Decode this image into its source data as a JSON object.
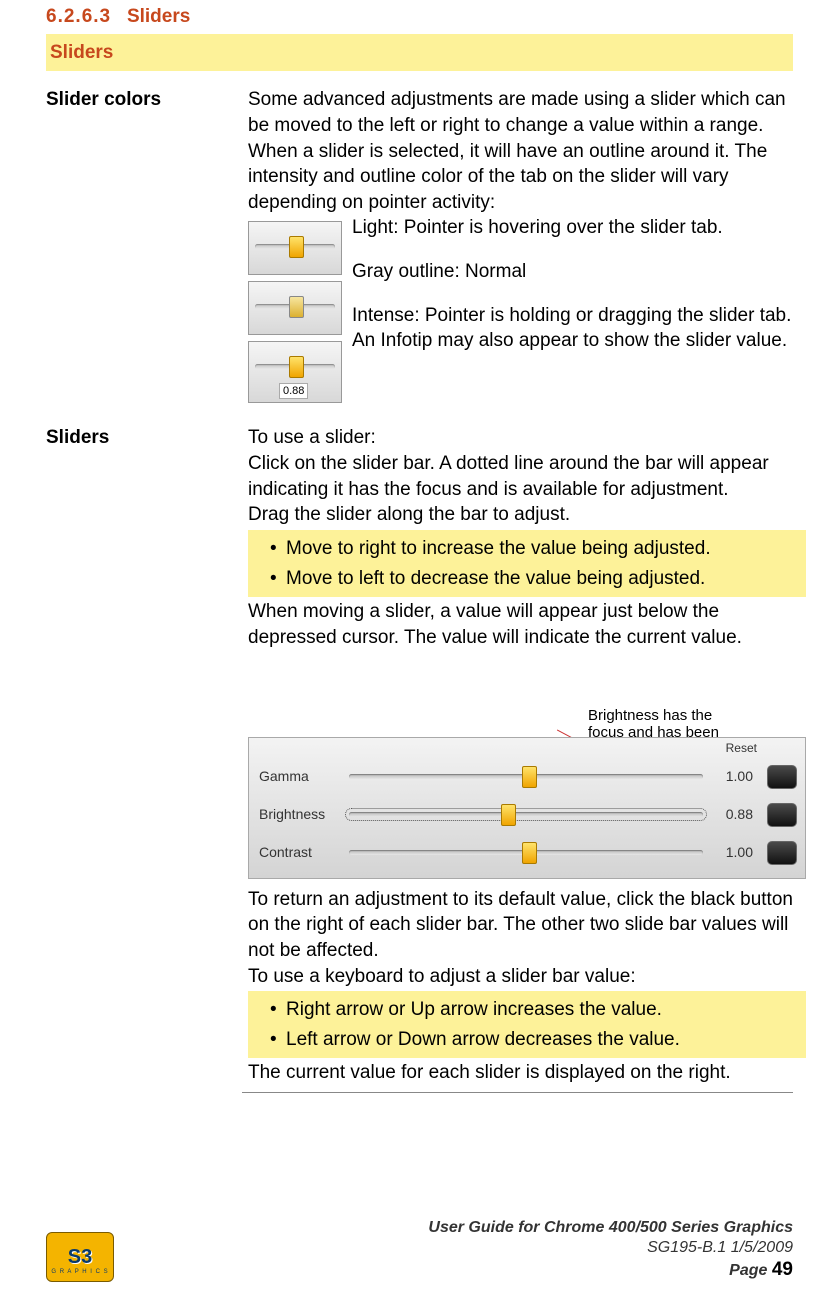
{
  "heading": {
    "number": "6.2.6.3",
    "title": "Sliders",
    "band": "Sliders"
  },
  "section1": {
    "label": "Slider colors",
    "intro": "Some advanced adjustments are made using a slider which can be moved to the left or right to change a value within a range. When a slider is selected, it will have an outline around it. The intensity and outline color of the tab on the slider will vary depending on pointer activity:",
    "state_light": "Light: Pointer is hovering over the slider tab.",
    "state_gray": "Gray outline: Normal",
    "state_intense": "Intense: Pointer is holding or dragging the slider tab. An Infotip may also appear to show the slider value.",
    "thumb_value": "0.88"
  },
  "section2": {
    "label": "Sliders",
    "p1": "To use a slider:",
    "p2": "Click on the slider bar. A dotted line around the bar will appear indicating it has the focus and is available for adjustment.",
    "p3": "Drag the slider along the bar to adjust.",
    "bullets1": {
      "b1": "Move to right to increase the value being adjusted.",
      "b2": "Move to left to decrease the value being adjusted."
    },
    "p4": "When moving a slider, a value will appear just below the depressed cursor. The value will indicate the current value.",
    "annotation": "Brightness has the focus and has been decreased",
    "panel": {
      "reset": "Reset",
      "rows": {
        "r1": {
          "label": "Gamma",
          "value": "1.00"
        },
        "r2": {
          "label": "Brightness",
          "value": "0.88"
        },
        "r3": {
          "label": "Contrast",
          "value": "1.00"
        }
      }
    },
    "p5": "To return an adjustment to its default value, click the black button on the right of each slider bar. The other two slide bar values will not be affected.",
    "p6": "To use a keyboard to adjust a slider bar value:",
    "bullets2": {
      "b1": "Right arrow or Up arrow increases the value.",
      "b2": "Left arrow or Down arrow decreases the value."
    },
    "p7": "The current value for each slider is displayed on the right."
  },
  "footer": {
    "title": "User Guide for Chrome 400/500 Series Graphics",
    "ref": "SG195-B.1   1/5/2009",
    "page_label": "Page ",
    "page_num": "49",
    "logo_text": "S3",
    "logo_sub": "G R A P H I C S"
  }
}
